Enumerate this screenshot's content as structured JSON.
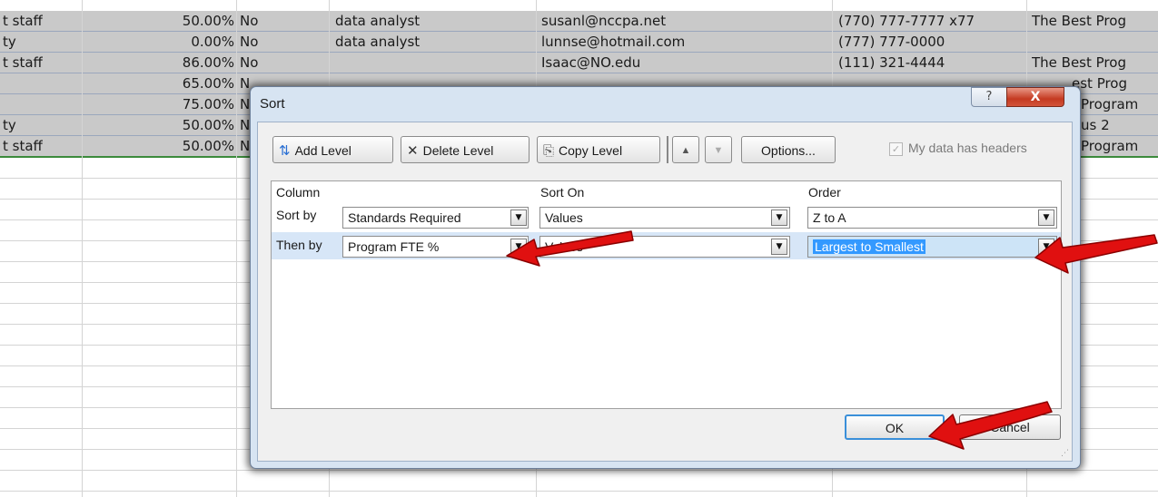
{
  "sheet": {
    "rows": [
      {
        "a": "t staff",
        "b": "50.00%",
        "c": "No",
        "d": "data analyst",
        "e": "susanl@nccpa.net",
        "f": "(770) 777-7777 x77",
        "g": "The Best Prog"
      },
      {
        "a": "ty",
        "b": "0.00%",
        "c": "No",
        "d": "data analyst",
        "e": "lunnse@hotmail.com",
        "f": "(777) 777-0000",
        "g": ""
      },
      {
        "a": "t staff",
        "b": "86.00%",
        "c": "No",
        "d": "",
        "e": "Isaac@NO.edu",
        "f": "(111) 321-4444",
        "g": "The Best Prog"
      },
      {
        "a": "",
        "b": "65.00%",
        "c": "N",
        "d": "",
        "e": "",
        "f": "",
        "g": "est Prog"
      },
      {
        "a": "",
        "b": "75.00%",
        "c": "N",
        "d": "",
        "e": "",
        "f": "",
        "g": "Program"
      },
      {
        "a": "ty",
        "b": "50.00%",
        "c": "N",
        "d": "",
        "e": "",
        "f": "",
        "g": "us 2"
      },
      {
        "a": "t staff",
        "b": "50.00%",
        "c": "N",
        "d": "",
        "e": "",
        "f": "",
        "g": "Program"
      }
    ]
  },
  "dialog": {
    "title": "Sort",
    "help_label": "?",
    "close_label": "X",
    "toolbar": {
      "add_level": "Add Level",
      "delete_level": "Delete Level",
      "copy_level": "Copy Level",
      "options": "Options...",
      "my_data_has_headers": "My data has headers"
    },
    "grid": {
      "headers": {
        "column": "Column",
        "sort_on": "Sort On",
        "order": "Order"
      },
      "levels": [
        {
          "label": "Sort by",
          "column": "Standards  Required",
          "sort_on": "Values",
          "order": "Z to A"
        },
        {
          "label": "Then by",
          "column": "Program FTE %",
          "sort_on": "Values",
          "order": "Largest to Smallest"
        }
      ]
    },
    "ok_label": "OK",
    "cancel_label": "Cancel"
  },
  "colors": {
    "arrow": "#e01010",
    "selection": "#3399ff",
    "dialog_frame": "#d7e4f2",
    "row_fill": "#c9c9c9"
  }
}
